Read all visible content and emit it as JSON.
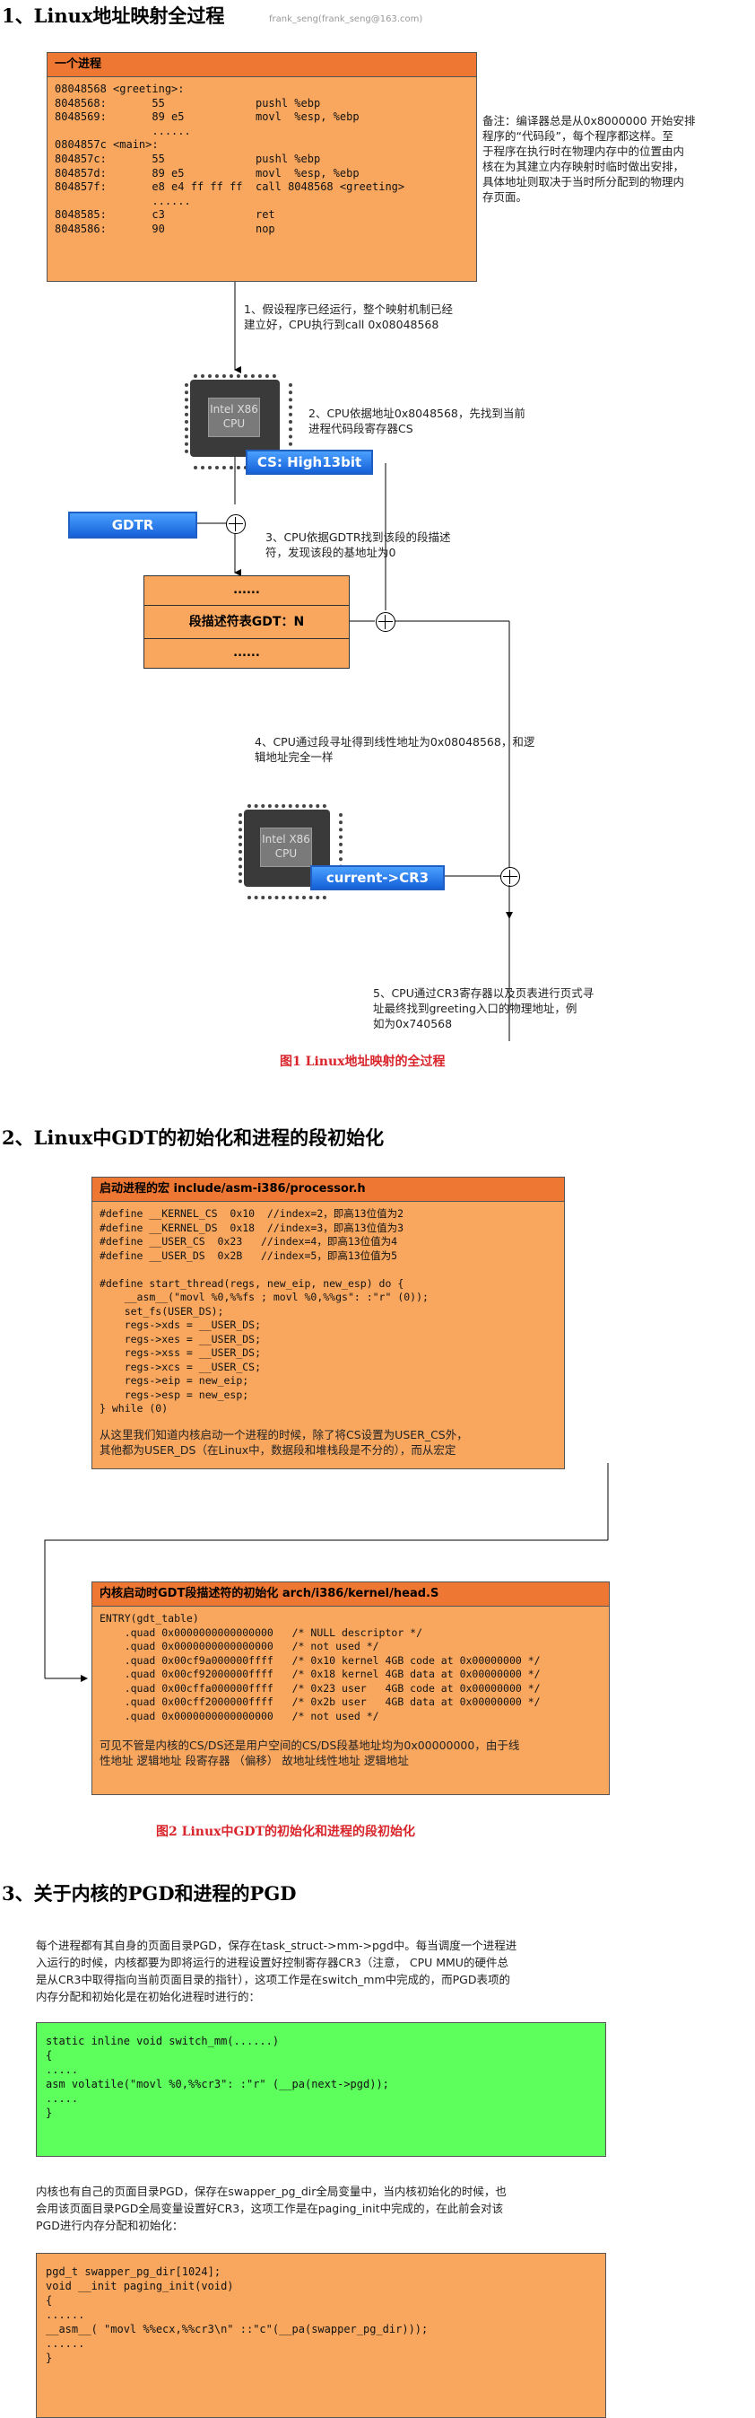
{
  "section1": {
    "heading": "1、Linux地址映射全过程",
    "watermark": "frank_seng(frank_seng@163.com)",
    "process_box": {
      "title": "一个进程",
      "lines": [
        "08048568 <greeting>:",
        "8048568:       55              pushl %ebp",
        "8048569:       89 e5           movl  %esp, %ebp",
        "               ......",
        "0804857c <main>:",
        "804857c:       55              pushl %ebp",
        "804857d:       89 e5           movl  %esp, %ebp",
        "804857f:       e8 e4 ff ff ff  call 8048568 <greeting>",
        "               ......",
        "8048585:       c3              ret",
        "8048586:       90              nop"
      ]
    },
    "side_note": [
      "备注：编译器总是从0x8000000 开始安排",
      "程序的“代码段”，每个程序都这样。至",
      "于程序在执行时在物理内存中的位置由内",
      "核在为其建立内存映射时临时做出安排，",
      "具体地址则取决于当时所分配到的物理内",
      "存页面。"
    ],
    "step1": [
      "1、假设程序已经运行，整个映射机制已经",
      "建立好，CPU执行到call 0x08048568"
    ],
    "cpu1": "Intel X86\nCPU",
    "cs_label": "CS: High13bit",
    "step2": [
      "2、CPU依据地址0x8048568，先找到当前",
      "进程代码段寄存器CS"
    ],
    "gdtr_label": "GDTR",
    "step3": [
      "3、CPU依据GDTR找到该段的段描述",
      "符，发现该段的基地址为0"
    ],
    "gdt_box": {
      "top": "......",
      "middle": "段描述符表GDT：N",
      "bottom": "......"
    },
    "step4": [
      "4、CPU通过段寻址得到线性地址为0x08048568，和逻",
      "辑地址完全一样"
    ],
    "cpu2": "Intel X86\nCPU",
    "cr3_label": "current->CR3",
    "step5": [
      "5、CPU通过CR3寄存器以及页表进行页式寻",
      "址最终找到greeting入口的物理地址，例",
      "如为0x740568"
    ],
    "caption": "图1  Linux地址映射的全过程"
  },
  "section2": {
    "heading": "2、Linux中GDT的初始化和进程的段初始化",
    "macro_box": {
      "title": "启动进程的宏  include/asm-i386/processor.h",
      "lines": [
        "#define __KERNEL_CS  0x10  //index=2，即高13位值为2",
        "#define __KERNEL_DS  0x18  //index=3，即高13位值为3",
        "#define __USER_CS  0x23   //index=4，即高13位值为4",
        "#define __USER_DS  0x2B   //index=5，即高13位值为5",
        "",
        "#define start_thread(regs, new_eip, new_esp) do {",
        "    __asm__(\"movl %0,%%fs ; movl %0,%%gs\": :\"r\" (0));",
        "    set_fs(USER_DS);",
        "    regs->xds = __USER_DS;",
        "    regs->xes = __USER_DS;",
        "    regs->xss = __USER_DS;",
        "    regs->xcs = __USER_CS;",
        "    regs->eip = new_eip;",
        "    regs->esp = new_esp;",
        "} while (0)"
      ],
      "note": [
        "从这里我们知道内核启动一个进程的时候，除了将CS设置为USER_CS外，",
        "其他都为USER_DS（在Linux中，数据段和堆栈段是不分的），而从宏定"
      ]
    },
    "gdt_init_box": {
      "title": "内核启动时GDT段描述符的初始化  arch/i386/kernel/head.S",
      "lines": [
        "ENTRY(gdt_table)",
        "    .quad 0x0000000000000000   /* NULL descriptor */",
        "    .quad 0x0000000000000000   /* not used */",
        "    .quad 0x00cf9a000000ffff   /* 0x10 kernel 4GB code at 0x00000000 */",
        "    .quad 0x00cf92000000ffff   /* 0x18 kernel 4GB data at 0x00000000 */",
        "    .quad 0x00cffa000000ffff   /* 0x23 user   4GB code at 0x00000000 */",
        "    .quad 0x00cff2000000ffff   /* 0x2b user   4GB data at 0x00000000 */",
        "    .quad 0x0000000000000000   /* not used */"
      ],
      "note": [
        "可见不管是内核的CS/DS还是用户空间的CS/DS段基地址均为0x00000000，由于线",
        "性地址 逻辑地址 段寄存器 （偏移） 故地址线性地址 逻辑地址"
      ]
    },
    "caption": "图2  Linux中GDT的初始化和进程的段初始化"
  },
  "section3": {
    "heading": "3、关于内核的PGD和进程的PGD",
    "para1": [
      "每个进程都有其自身的页面目录PGD，保存在task_struct->mm->pgd中。每当调度一个进程进",
      "入运行的时候，内核都要为即将运行的进程设置好控制寄存器CR3（注意， CPU MMU的硬件总",
      "是从CR3中取得指向当前页面目录的指针），这项工作是在switch_mm中完成的，而PGD表项的",
      "内存分配和初始化是在初始化进程时进行的："
    ],
    "green_code": [
      "static inline void switch_mm(......)",
      "{",
      ".....",
      "asm volatile(\"movl %0,%%cr3\": :\"r\" (__pa(next->pgd));",
      ".....",
      "}"
    ],
    "para2": [
      "内核也有自己的页面目录PGD，保存在swapper_pg_dir全局变量中，当内核初始化的时候，也",
      "会用该页面目录PGD全局变量设置好CR3，这项工作是在paging_init中完成的，在此前会对该",
      "PGD进行内存分配和初始化："
    ],
    "orange_code": [
      "pgd_t swapper_pg_dir[1024];",
      "void __init paging_init(void)",
      "{",
      "......",
      "__asm__( \"movl %%ecx,%%cr3\\n\" ::\"c\"(__pa(swapper_pg_dir)));",
      "......",
      "}"
    ]
  }
}
